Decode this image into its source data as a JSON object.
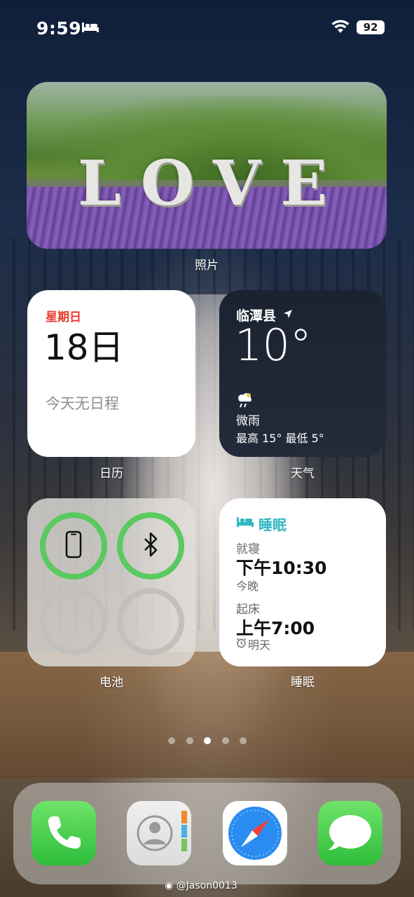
{
  "status_bar": {
    "time": "9:59",
    "battery": "92"
  },
  "photo_widget": {
    "overlay_text": "LOVE",
    "label": "照片"
  },
  "calendar_widget": {
    "weekday": "星期日",
    "date": "18日",
    "events": "今天无日程",
    "label": "日历"
  },
  "weather_widget": {
    "city": "临潭县",
    "temperature": "10°",
    "condition": "微雨",
    "range": "最高 15° 最低 5°",
    "label": "天气"
  },
  "battery_widget": {
    "label": "电池",
    "devices": [
      "iphone-icon",
      "bluetooth-icon"
    ]
  },
  "sleep_widget": {
    "title": "睡眠",
    "bedtime_label": "就寝",
    "bedtime": "下午10:30",
    "bedtime_day": "今晚",
    "wake_label": "起床",
    "wake": "上午7:00",
    "wake_day": "明天",
    "label": "睡眠",
    "accent": "#2fb8c4"
  },
  "page_dots": {
    "count": 5,
    "active_index": 2
  },
  "dock": {
    "apps": [
      "phone-app",
      "contacts-app",
      "safari-app",
      "messages-app"
    ]
  },
  "watermark": "@Jason0013",
  "colors": {
    "battery_green": "#5ac95f",
    "calendar_red": "#ea3b2e"
  }
}
